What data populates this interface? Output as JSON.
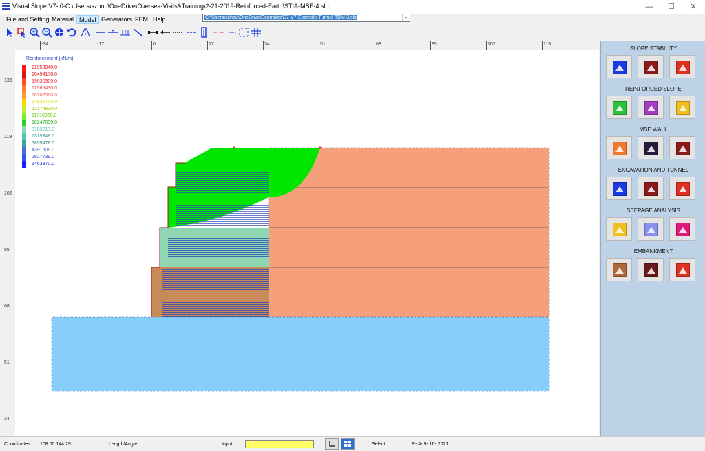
{
  "window": {
    "title": "Visual Slope V7- 0-C:\\Users\\szhou\\OneDrive\\Oversea-Visits&Training\\2-21-2019-Reinforced-Earth\\STIA-MSE-4.slp",
    "minimize": "—",
    "maximize": "☐",
    "close": "✕"
  },
  "menu": {
    "items": [
      "File and Setting",
      "Material",
      "Model",
      "Generators",
      "FEM",
      "Help"
    ],
    "active": "Model"
  },
  "path_dropdown": {
    "value": "C:\\Users\\szhou\\OneDrive\\Examples\\07-V7-Example-Tunnel-TBM-3.slp"
  },
  "toolbar": {
    "icons": [
      "select-arrow-icon",
      "select-node-icon",
      "zoom-in-icon",
      "zoom-out-icon",
      "pan-icon",
      "undo-icon",
      "slope-icon",
      "line-icon",
      "water-table-icon",
      "piles-icon",
      "diagonal-line-icon",
      "anchor-icon",
      "load-arrow-icon",
      "geogrid-icon",
      "column-icon",
      "dotted-line-icon",
      "dotted-box-icon",
      "grid-icon"
    ]
  },
  "ruler": {
    "top_labels": [
      "-34",
      "-17",
      "0",
      "17",
      "34",
      "51",
      "68",
      "85",
      "102",
      "118"
    ],
    "left_labels": [
      "136",
      "119",
      "102",
      "85",
      "68",
      "51",
      "34"
    ]
  },
  "legend": {
    "title": "Reinforcement (kN/m)",
    "values": [
      "21958040.0",
      "20494170.0",
      "19030300.0",
      "17566430.0",
      "16102560.0",
      "14638700.0",
      "13174830.0",
      "11710960.0",
      "10247090.0",
      "8783217.0",
      "7319348.0",
      "5855478.0",
      "4391609.0",
      "2927739.0",
      "1463870.0"
    ],
    "colors": [
      "#ff1a1a",
      "#d21c1c",
      "#ff4a2a",
      "#ff7a30",
      "#ff9a30",
      "#ffd400",
      "#c6ef3a",
      "#7cf02a",
      "#2fd12f",
      "#88d9b8",
      "#58c6a8",
      "#3aa59b",
      "#4a6fd1",
      "#3355e6",
      "#1a1aff"
    ],
    "text_colors": [
      "#d11",
      "#d11",
      "#e23",
      "#e44",
      "#e66",
      "#dd0",
      "#9c0",
      "#6c0",
      "#2a2",
      "#5bb",
      "#399",
      "#377",
      "#36b",
      "#34d",
      "#22e"
    ]
  },
  "model_colors": {
    "green_zone": "#00e600",
    "salmon": "#f5a07a",
    "blue_base": "#87cefa",
    "reinforcement_line": "#2b4ab8",
    "teal_zone": "#8fd7b0",
    "brown_zone": "#c98a5a"
  },
  "side_panel": {
    "sections": [
      {
        "title": "SLOPE STABILITY",
        "buttons": [
          "slope-stability-icon",
          "slope-profile-icon",
          "slope-slip-icon"
        ],
        "colors": [
          "#1a3adf",
          "#8b1a1a",
          "#e03022"
        ]
      },
      {
        "title": "REINFORCED SLOPE",
        "buttons": [
          "reinforced-slope-green-icon",
          "reinforced-slope-purple-icon",
          "reinforced-slope-yellow-icon"
        ],
        "colors": [
          "#2fbf3f",
          "#a040c0",
          "#f0c020"
        ]
      },
      {
        "title": "MSE WALL",
        "buttons": [
          "mse-wall-orange-icon",
          "mse-wall-dark-icon",
          "mse-wall-red-icon"
        ],
        "colors": [
          "#f07830",
          "#2a1a3a",
          "#8b1a1a"
        ]
      },
      {
        "title": "EXCAVATION AND TUNNEL",
        "buttons": [
          "excavation-snow-icon",
          "excavation-wall-icon",
          "tunnel-icon"
        ],
        "colors": [
          "#1a3adf",
          "#8b1a1a",
          "#e03022"
        ]
      },
      {
        "title": "SEEPAGE ANALYSIS",
        "buttons": [
          "seepage-yellow-icon",
          "seepage-blue-icon",
          "seepage-pink-icon"
        ],
        "colors": [
          "#f0c020",
          "#8a90f0",
          "#e01a7a"
        ]
      },
      {
        "title": "EMBANKMENT",
        "buttons": [
          "embankment-brown-icon",
          "embankment-dark-icon",
          "embankment-pile-icon"
        ],
        "colors": [
          "#b06a3a",
          "#6a1a1a",
          "#e03022"
        ]
      }
    ]
  },
  "statusbar": {
    "coordinates_label": "Coordinates:",
    "coordinates_value": "108.00  144.29",
    "length_label": "Length/Angle:",
    "input_label": "Input:",
    "select_label": "Select",
    "version": "R- 4- 9- 16- 2021"
  }
}
